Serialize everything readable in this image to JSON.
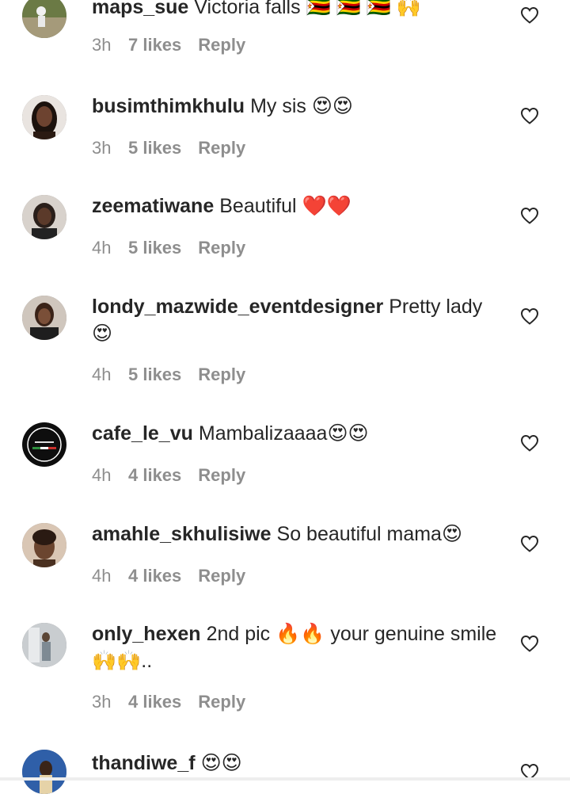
{
  "comments": [
    {
      "username": "maps_sue",
      "text": "Victoria falls 🇿🇼 🇿🇼 🇿🇼 🙌",
      "time": "3h",
      "likes": "7 likes",
      "reply": "Reply",
      "avatar_color": "#5c6b3c"
    },
    {
      "username": "busimthimkhulu",
      "text": "My sis 😍😍",
      "time": "3h",
      "likes": "5 likes",
      "reply": "Reply",
      "avatar_color": "#3a2418"
    },
    {
      "username": "zeematiwane",
      "text": "Beautiful ❤️❤️",
      "time": "4h",
      "likes": "5 likes",
      "reply": "Reply",
      "avatar_color": "#2f2a28"
    },
    {
      "username": "londy_mazwide_eventdesigner",
      "text": "Pretty lady 😍",
      "time": "4h",
      "likes": "5 likes",
      "reply": "Reply",
      "avatar_color": "#5a4032"
    },
    {
      "username": "cafe_le_vu",
      "text": "Mambalizaaaa😍😍",
      "time": "4h",
      "likes": "4 likes",
      "reply": "Reply",
      "avatar_color": "#111111"
    },
    {
      "username": "amahle_skhulisiwe",
      "text": "So beautiful mama😍",
      "time": "4h",
      "likes": "4 likes",
      "reply": "Reply",
      "avatar_color": "#b89a80"
    },
    {
      "username": "only_hexen",
      "text": "2nd pic 🔥🔥 your genuine smile 🙌🙌..",
      "time": "3h",
      "likes": "4 likes",
      "reply": "Reply",
      "avatar_color": "#9aa3aa"
    },
    {
      "username": "thandiwe_f",
      "text": "😍😍",
      "avatar_color": "#3b6db0"
    }
  ]
}
